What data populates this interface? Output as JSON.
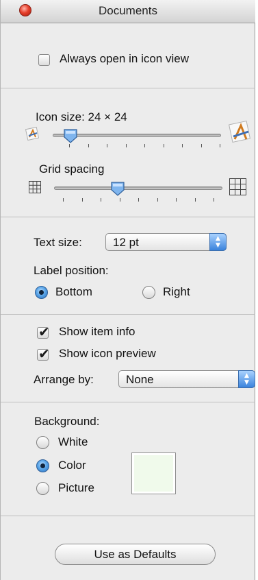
{
  "window": {
    "title": "Documents"
  },
  "icon_view": {
    "always_open_label": "Always open in icon view",
    "checked": false
  },
  "icon_size": {
    "label": "Icon size: 24 × 24",
    "value_fraction": 0.0
  },
  "grid_spacing": {
    "label": "Grid spacing",
    "value_fraction": 0.4
  },
  "text_size": {
    "label": "Text size:",
    "value": "12 pt"
  },
  "label_position": {
    "label": "Label position:",
    "options": [
      "Bottom",
      "Right"
    ],
    "selected": "Bottom"
  },
  "show": {
    "item_info_label": "Show item info",
    "item_info_checked": true,
    "icon_preview_label": "Show icon preview",
    "icon_preview_checked": true
  },
  "arrange_by": {
    "label": "Arrange by:",
    "value": "None"
  },
  "background": {
    "label": "Background:",
    "options": [
      "White",
      "Color",
      "Picture"
    ],
    "selected": "Color",
    "color": "#f0faeb"
  },
  "buttons": {
    "use_as_defaults": "Use as Defaults"
  }
}
